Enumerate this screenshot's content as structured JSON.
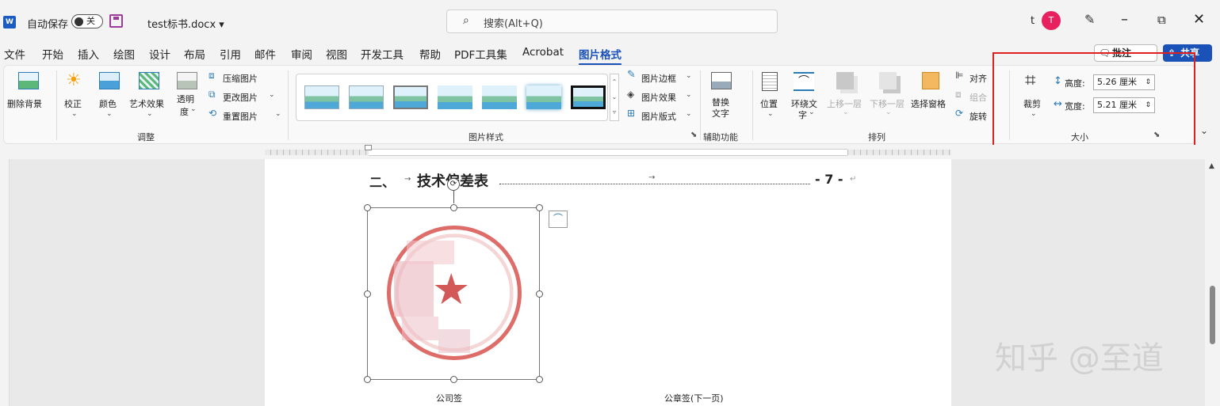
{
  "titlebar": {
    "autosave_label": "自动保存",
    "toggle_label": "关",
    "filename": "test标书.docx ▾",
    "search_placeholder": "搜索(Alt+Q)",
    "user_initial": "t",
    "avatar_letter": "T"
  },
  "menu": {
    "items": [
      "文件",
      "开始",
      "插入",
      "绘图",
      "设计",
      "布局",
      "引用",
      "邮件",
      "审阅",
      "视图",
      "开发工具",
      "帮助",
      "PDF工具集",
      "Acrobat",
      "图片格式"
    ],
    "active": "图片格式",
    "comment_label": "批注",
    "share_label": "共享"
  },
  "ribbon": {
    "adjust": {
      "remove_bg": "删除背景",
      "correct": "校正",
      "color": "颜色",
      "artistic": "艺术效果",
      "transparency_1": "透明",
      "transparency_2": "度",
      "compress": "压缩图片",
      "change": "更改图片",
      "reset": "重置图片",
      "group_label": "调整"
    },
    "styles": {
      "border": "图片边框",
      "effects": "图片效果",
      "layout": "图片版式",
      "group_label": "图片样式"
    },
    "accessibility": {
      "alt_text_1": "替换",
      "alt_text_2": "文字",
      "group_label": "辅助功能"
    },
    "arrange": {
      "position": "位置",
      "wrap_1": "环绕文",
      "wrap_2": "字",
      "bring_forward": "上移一层",
      "send_backward": "下移一层",
      "selection_pane": "选择窗格",
      "align": "对齐",
      "group": "组合",
      "rotate": "旋转",
      "group_label": "排列"
    },
    "size": {
      "crop": "裁剪",
      "height_label": "高度:",
      "height_value": "5.26 厘米",
      "width_label": "宽度:",
      "width_value": "5.21 厘米",
      "group_label": "大小"
    }
  },
  "document": {
    "heading_num": "二、",
    "heading_text": "技术偏差表",
    "page_ref": "- 7 -",
    "footer_left": "公司签",
    "footer_right": "公章签(下一页)"
  },
  "watermark": "知乎 @至道",
  "colors": {
    "accent": "#1a52b8",
    "highlight_box": "#e02020",
    "seal": "#d9534f",
    "avatar": "#e8205f"
  }
}
